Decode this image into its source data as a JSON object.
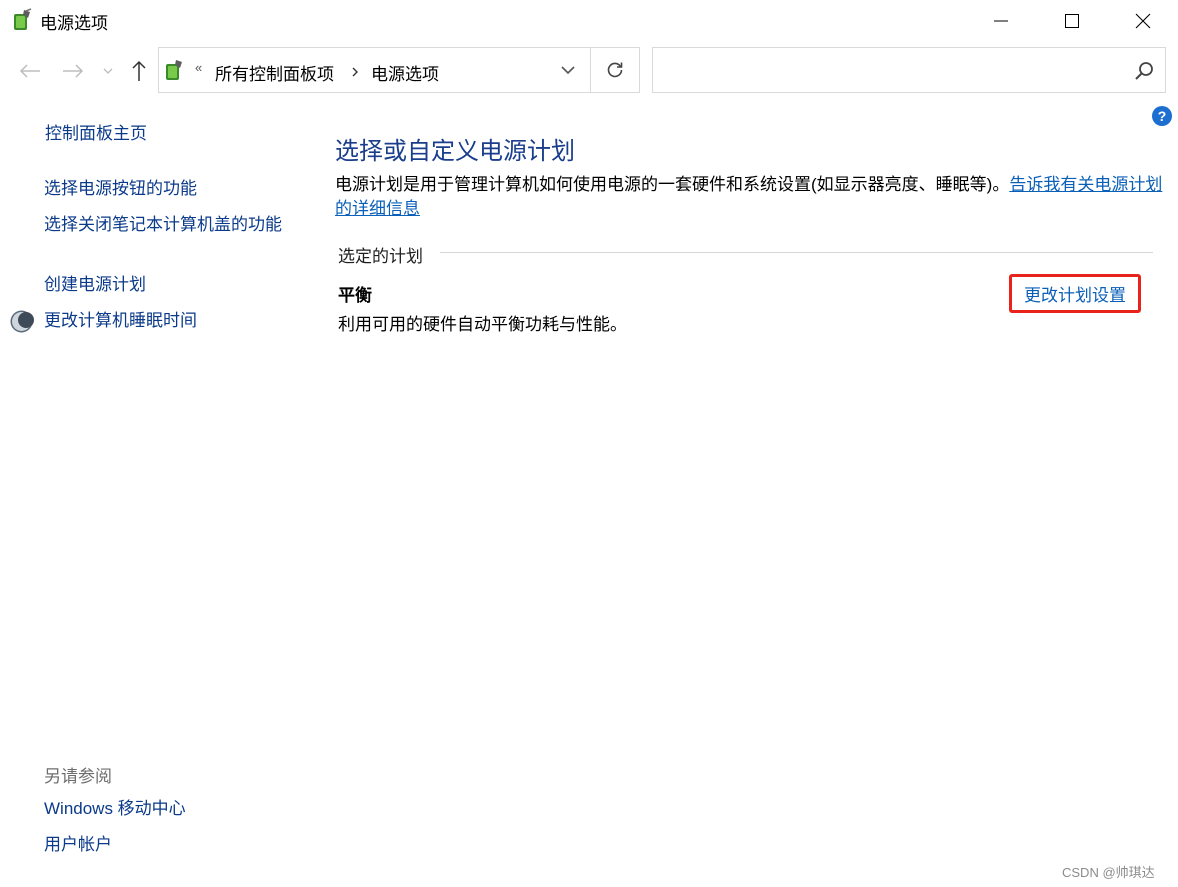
{
  "window": {
    "title": "电源选项",
    "icon": "power-options-icon"
  },
  "nav": {
    "back_icon": "arrow-left-icon",
    "forward_icon": "arrow-right-icon",
    "recent_icon": "chevron-down-icon",
    "up_icon": "arrow-up-icon",
    "breadcrumb_overflow": "«",
    "breadcrumb": [
      "所有控制面板项",
      "电源选项"
    ],
    "search_placeholder": ""
  },
  "sidebar": {
    "home": "控制面板主页",
    "items": [
      "选择电源按钮的功能",
      "选择关闭笔记本计算机盖的功能",
      "创建电源计划",
      "更改计算机睡眠时间"
    ],
    "see_also_heading": "另请参阅",
    "see_also": [
      "Windows 移动中心",
      "用户帐户"
    ]
  },
  "main": {
    "title": "选择或自定义电源计划",
    "description": "电源计划是用于管理计算机如何使用电源的一套硬件和系统设置(如显示器亮度、睡眠等)。",
    "description_link": "告诉我有关电源计划的详细信息",
    "section_label": "选定的计划",
    "plan": {
      "name": "平衡",
      "description": "利用可用的硬件自动平衡功耗与性能。",
      "change_link": "更改计划设置"
    },
    "help_label": "?"
  },
  "watermark": "CSDN @帅琪达",
  "colors": {
    "link": "#0a5fb8",
    "title": "#1a3e8c",
    "highlight_border": "#e8231c"
  }
}
